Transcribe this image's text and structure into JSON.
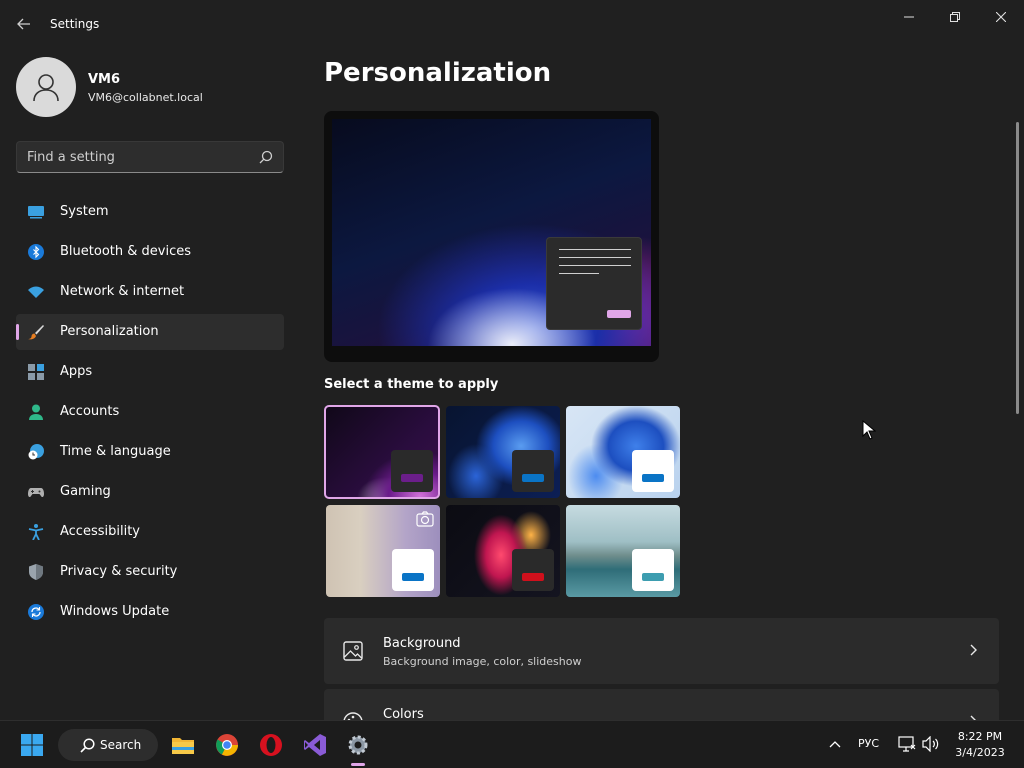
{
  "window": {
    "title": "Settings",
    "back_icon": "back-arrow-icon",
    "controls": [
      "minimize-icon",
      "restore-icon",
      "close-icon"
    ]
  },
  "user": {
    "name": "VM6",
    "email": "VM6@collabnet.local",
    "avatar_icon": "user-avatar-icon"
  },
  "search": {
    "placeholder": "Find a setting",
    "icon": "search-icon"
  },
  "sidebar": {
    "items": [
      {
        "label": "System",
        "icon": "system-icon",
        "active": false
      },
      {
        "label": "Bluetooth & devices",
        "icon": "bluetooth-icon",
        "active": false
      },
      {
        "label": "Network & internet",
        "icon": "wifi-icon",
        "active": false
      },
      {
        "label": "Personalization",
        "icon": "brush-icon",
        "active": true
      },
      {
        "label": "Apps",
        "icon": "apps-icon",
        "active": false
      },
      {
        "label": "Accounts",
        "icon": "accounts-icon",
        "active": false
      },
      {
        "label": "Time & language",
        "icon": "clock-globe-icon",
        "active": false
      },
      {
        "label": "Gaming",
        "icon": "gamepad-icon",
        "active": false
      },
      {
        "label": "Accessibility",
        "icon": "accessibility-icon",
        "active": false
      },
      {
        "label": "Privacy & security",
        "icon": "shield-icon",
        "active": false
      },
      {
        "label": "Windows Update",
        "icon": "update-icon",
        "active": false
      }
    ]
  },
  "main": {
    "title": "Personalization",
    "theme_heading": "Select a theme to apply",
    "themes": [
      {
        "name": "dark-purple-bloom",
        "accent": "#6b1e8a",
        "selected": true
      },
      {
        "name": "dark-blue-bloom",
        "accent": "#0a74c6",
        "selected": false
      },
      {
        "name": "light-blue-bloom",
        "accent": "#0a74c6",
        "selected": false
      },
      {
        "name": "captured-motion",
        "accent": "#0a74c6",
        "selected": false
      },
      {
        "name": "glow",
        "accent": "#d0101c",
        "selected": false
      },
      {
        "name": "sunrise-lake",
        "accent": "#3d9db0",
        "selected": false
      }
    ],
    "cards": [
      {
        "title": "Background",
        "subtitle": "Background image, color, slideshow",
        "icon": "image-icon"
      },
      {
        "title": "Colors",
        "subtitle": "",
        "icon": "palette-icon"
      }
    ]
  },
  "taskbar": {
    "search_label": "Search",
    "apps": [
      "start-icon",
      "file-explorer-icon",
      "chrome-icon",
      "opera-icon",
      "visual-studio-icon",
      "settings-gear-icon"
    ],
    "tray": {
      "language": "РУС",
      "time": "8:22 PM",
      "date": "3/4/2023"
    }
  },
  "colors": {
    "accent": "#e0a6e8",
    "background": "#202020",
    "card": "#2b2b2b"
  }
}
